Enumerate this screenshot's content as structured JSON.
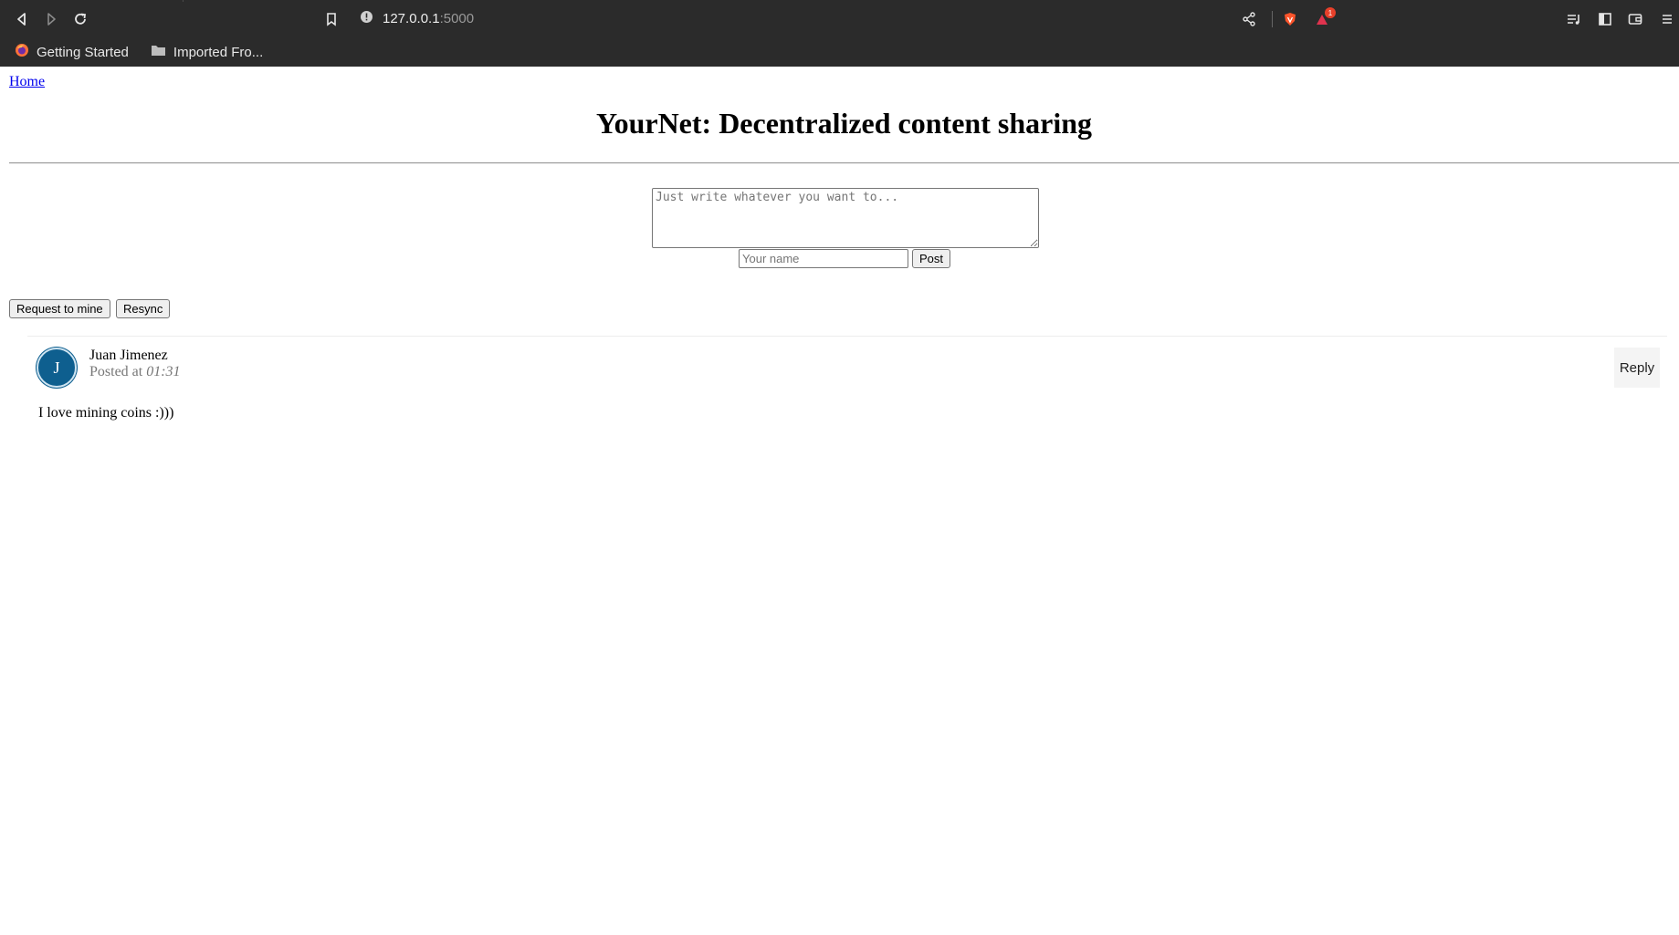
{
  "browser": {
    "url_host": "127.0.0.1",
    "url_port": ":5000",
    "notification_count": "1",
    "bookmarks": [
      {
        "label": "Getting Started"
      },
      {
        "label": "Imported Fro..."
      }
    ]
  },
  "page": {
    "home_link": "Home",
    "title": "YourNet: Decentralized content sharing",
    "compose": {
      "placeholder": "Just write whatever you want to...",
      "name_placeholder": "Your name",
      "post_label": "Post"
    },
    "actions": {
      "mine_label": "Request to mine",
      "resync_label": "Resync"
    },
    "posts": [
      {
        "avatar_initial": "J",
        "author": "Juan Jimenez",
        "posted_prefix": "Posted at",
        "time": "01:31",
        "reply_label": "Reply",
        "content": "I love mining coins :)))"
      }
    ]
  }
}
